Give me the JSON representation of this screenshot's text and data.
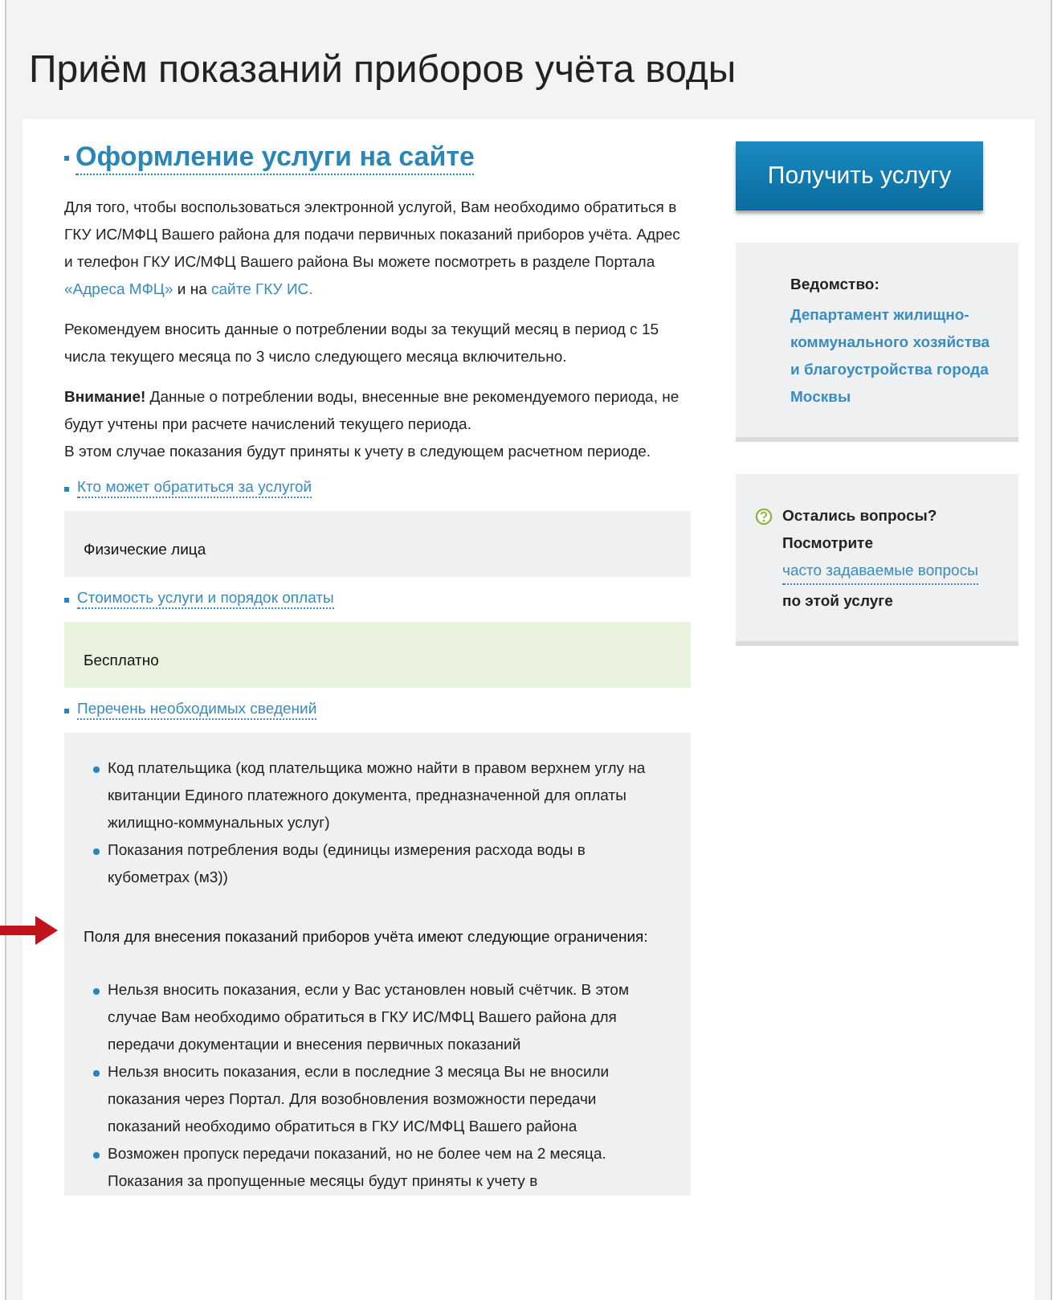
{
  "page_title": "Приём показаний приборов учёта воды",
  "section_heading": "Оформление услуги на сайте",
  "intro": [
    [
      {
        "kind": "text",
        "text": "Для того, чтобы воспользоваться электронной услугой, Вам необходимо обратиться в ГКУ ИС/МФЦ Вашего района для подачи первичных показаний приборов учёта. Адрес и телефон ГКУ ИС/МФЦ Вашего района Вы можете посмотреть в разделе Портала "
      },
      {
        "kind": "link",
        "text": "«Адреса МФЦ»"
      },
      {
        "kind": "text",
        "text": " и на "
      },
      {
        "kind": "link",
        "text": "сайте ГКУ ИС."
      }
    ],
    [
      {
        "kind": "text",
        "text": "Рекомендуем вносить данные о потреблении воды за текущий месяц в период с 15 числа текущего месяца по 3 число следующего месяца включительно."
      }
    ],
    [
      {
        "kind": "text",
        "text": "**Внимание!** Данные о потреблении воды, внесенные вне рекомендуемого периода, не будут учтены при расчете начислений текущего периода."
      },
      {
        "kind": "break"
      },
      {
        "kind": "text",
        "text": "В этом случае показания будут приняты к учету в следующем расчетном периоде."
      }
    ]
  ],
  "accordion": [
    {
      "title": "Кто может обратиться за услугой",
      "kind": "grey",
      "body": [
        {
          "kind": "para",
          "text": "Физические лица"
        }
      ]
    },
    {
      "title": "Стоимость услуги и порядок оплаты",
      "kind": "green",
      "body": [
        {
          "kind": "para",
          "text": "Бесплатно"
        }
      ]
    },
    {
      "title": "Перечень необходимых сведений",
      "kind": "grey",
      "body": [
        {
          "kind": "list",
          "items": [
            "Код плательщика (код плательщика можно найти в правом верхнем углу на квитанции Единого платежного документа, предназначенной для оплаты жилищно-коммунальных услуг)",
            "Показания потребления воды (единицы измерения расхода воды в кубометрах (м3))"
          ]
        },
        {
          "kind": "para",
          "text": "Поля для внесения показаний приборов учёта имеют следующие ограничения:"
        },
        {
          "kind": "list",
          "items": [
            "Нельзя вносить показания, если у Вас установлен новый счётчик. В этом случае Вам необходимо обратиться в ГКУ ИС/МФЦ Вашего района для передачи документации и внесения первичных показаний",
            "Нельзя вносить показания, если в последние 3 месяца Вы не вносили показания через Портал. Для возобновления возможности передачи показаний необходимо обратиться в ГКУ ИС/МФЦ Вашего района",
            "Возможен пропуск передачи показаний, но не более чем на 2 месяца. Показания за пропущенные месяцы будут приняты к учету в"
          ]
        }
      ]
    }
  ],
  "action_button": "Получить услугу",
  "agency": {
    "label": "Ведомство:",
    "name": "Департамент жилищно-коммунального хозяйства и благоустройства города Москвы"
  },
  "help": {
    "title": "Остались вопросы?",
    "prefix": "Посмотрите",
    "link": "часто задаваемые вопросы",
    "suffix": "по этой услуге"
  }
}
